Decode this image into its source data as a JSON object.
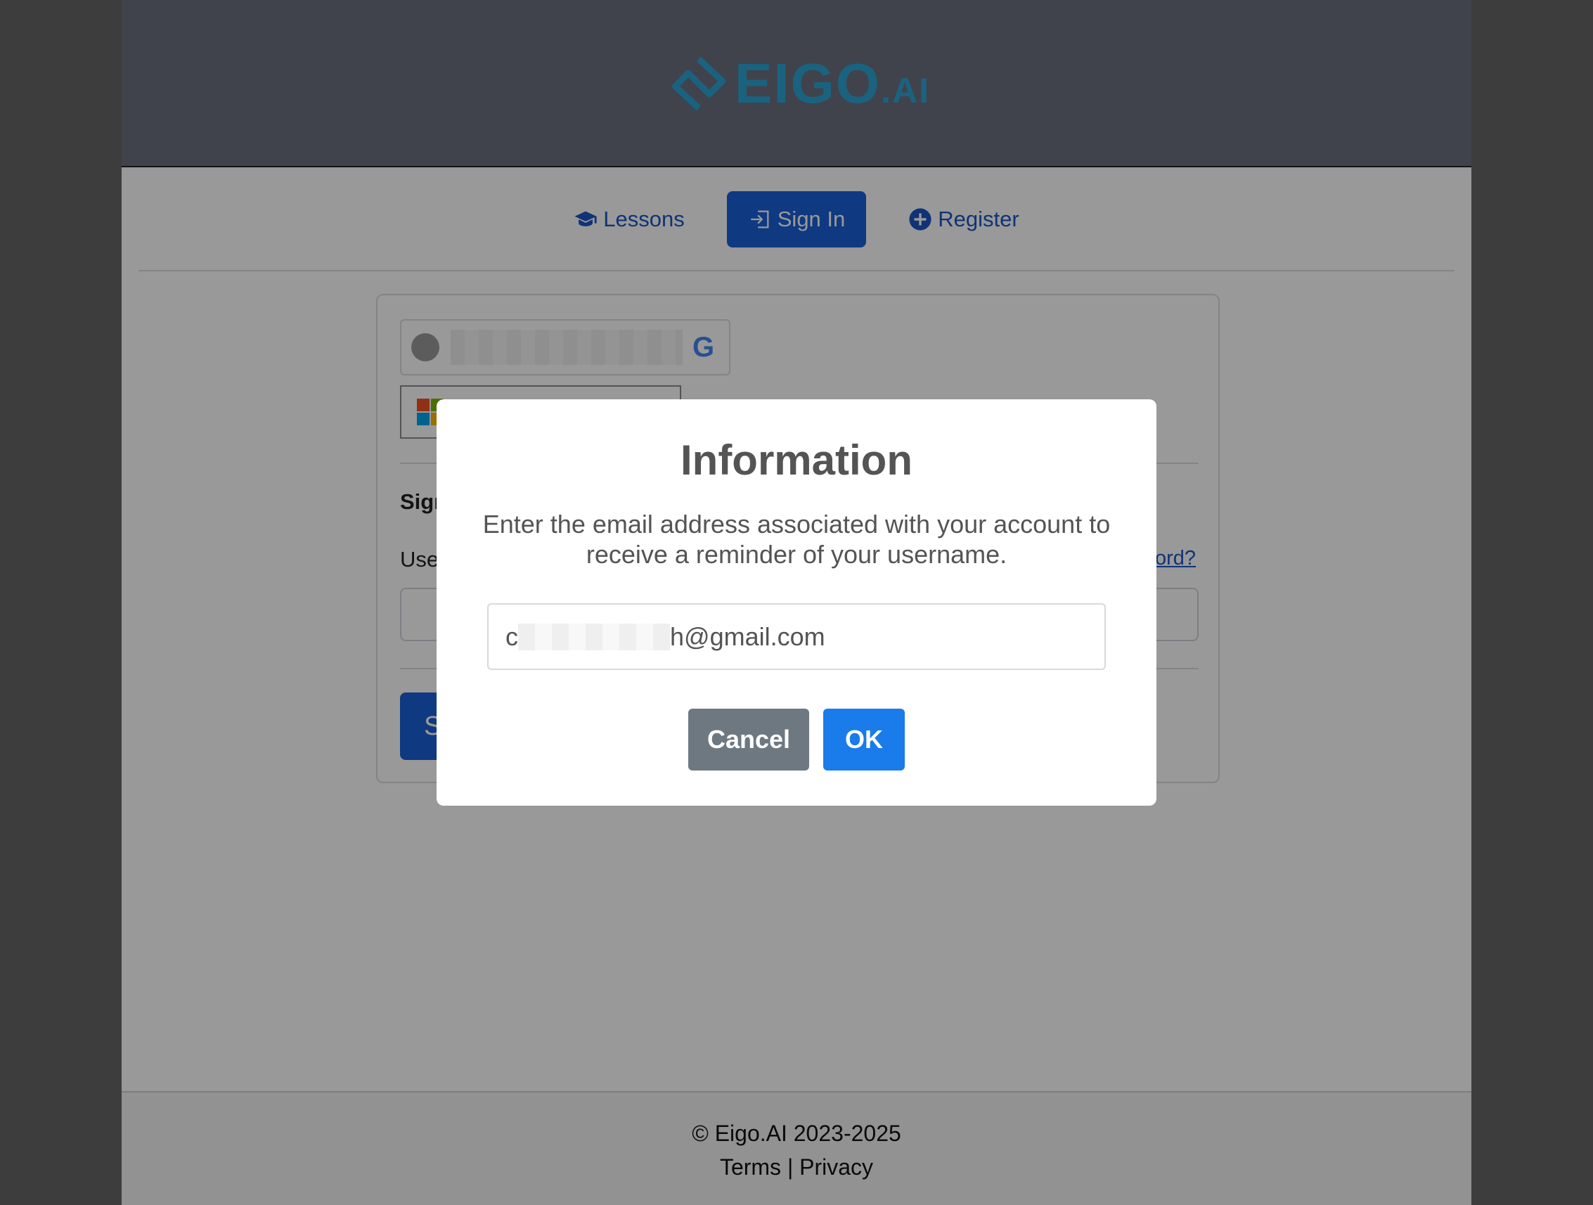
{
  "brand": {
    "logo_main": "EIGO",
    "logo_suffix": ".AI"
  },
  "nav": {
    "lessons": "Lessons",
    "sign_in": "Sign In",
    "register": "Register"
  },
  "card": {
    "title_partial": "Sign",
    "username_label_partial": "Use",
    "forgot_link_partial": "ord?",
    "submit_partial": "S"
  },
  "modal": {
    "title": "Information",
    "message": "Enter the email address associated with your account to receive a reminder of your username.",
    "email_prefix": "c",
    "email_suffix": "h@gmail.com",
    "cancel_label": "Cancel",
    "ok_label": "OK"
  },
  "footer": {
    "copyright": "© Eigo.AI 2023-2025",
    "terms": "Terms",
    "separator": "|",
    "privacy": "Privacy"
  },
  "colors": {
    "accent": "#1a5fd8",
    "ok_button": "#1a7bea",
    "cancel_button": "#6e7881",
    "logo": "#2aa6d6"
  }
}
